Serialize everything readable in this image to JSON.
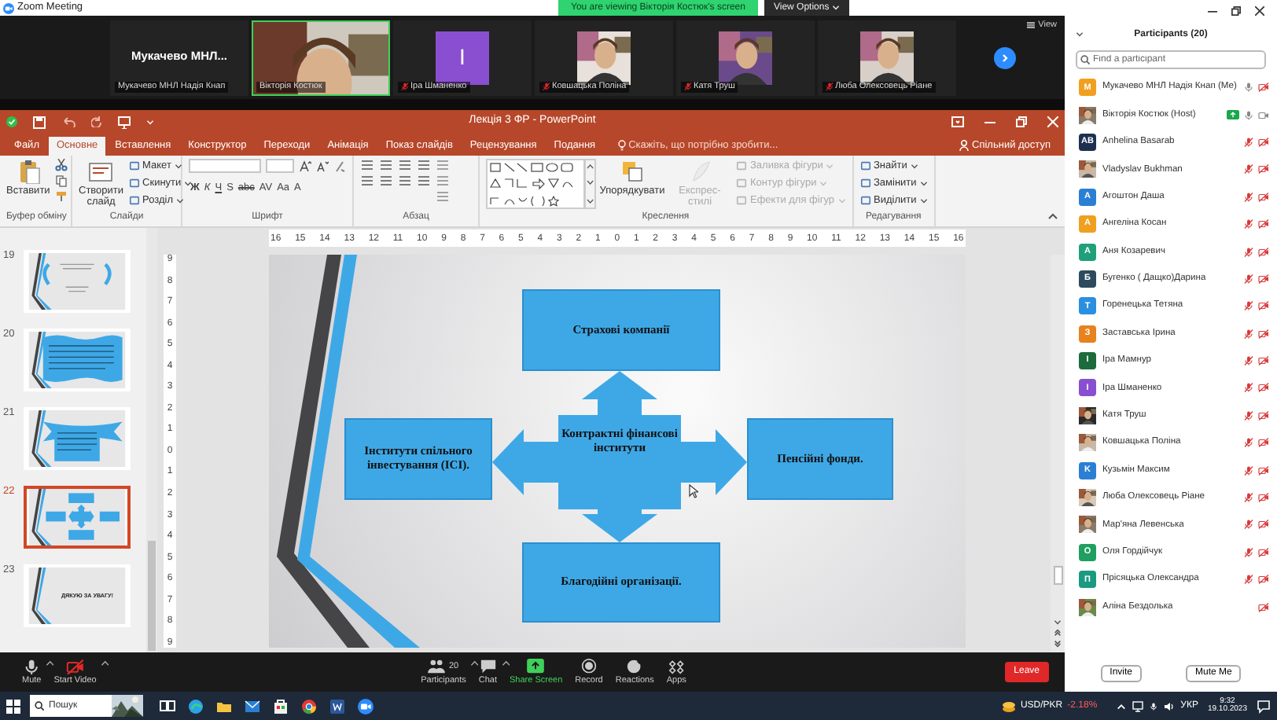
{
  "title_bar": {
    "title": "Zoom Meeting"
  },
  "share_banner": {
    "text": "You are viewing Вікторія Костюк's screen",
    "button": "View Options"
  },
  "gallery": {
    "tiles": [
      {
        "kind": "name",
        "display": "Мукачево  МНЛ...",
        "label": "Мукачево МНЛ Надія Кнап",
        "muted": false,
        "speaking": false
      },
      {
        "kind": "video",
        "label": "Вікторія Костюк",
        "muted": false,
        "speaking": true
      },
      {
        "kind": "letter",
        "initial": "І",
        "color": "#8a4fd0",
        "label": "Іра Шманенко",
        "muted": true,
        "speaking": false
      },
      {
        "label": "Ковшацька Поліна",
        "muted": true,
        "speaking": false
      },
      {
        "label": "Катя Труш",
        "muted": true,
        "speaking": false
      },
      {
        "label": "Люба Олексовець Ріане",
        "muted": true,
        "speaking": false
      }
    ],
    "view_label": "View"
  },
  "powerpoint": {
    "title": "Лекція 3 ФР  -  PowerPoint",
    "file_tab": "Файл",
    "tabs": [
      {
        "label": "Основне",
        "selected": true
      },
      {
        "label": "Вставлення",
        "selected": false
      },
      {
        "label": "Конструктор",
        "selected": false
      },
      {
        "label": "Переходи",
        "selected": false
      },
      {
        "label": "Анімація",
        "selected": false
      },
      {
        "label": "Показ слайдів",
        "selected": false
      },
      {
        "label": "Рецензування",
        "selected": false
      },
      {
        "label": "Подання",
        "selected": false
      }
    ],
    "tell_me": "Скажіть, що потрібно зробити...",
    "share": "Спільний доступ",
    "ribbon": [
      {
        "kind": "clipboard",
        "label": "Буфер обміну",
        "large": [
          {
            "label": "Вставити",
            "disabled": false
          }
        ]
      },
      {
        "kind": "slides",
        "label": "Слайди",
        "large": [
          {
            "label": "Створити слайд",
            "disabled": false
          }
        ],
        "small": [
          {
            "label": "Макет",
            "disabled": false
          },
          {
            "label": "Скинути",
            "disabled": false
          },
          {
            "label": "Розділ",
            "disabled": false
          }
        ]
      },
      {
        "kind": "font",
        "label": "Шрифт",
        "font_buttons": [
          "Ж",
          "К",
          "Ч",
          "S",
          "abc",
          "AV",
          "Aa",
          "A"
        ]
      },
      {
        "kind": "paragraph",
        "label": "Абзац"
      },
      {
        "kind": "drawing",
        "label": "Креслення",
        "large": [
          {
            "label": "Упорядкувати",
            "disabled": false
          },
          {
            "label": "Експрес-стилі",
            "disabled": true
          }
        ],
        "small": [
          {
            "label": "Заливка фігури",
            "disabled": true
          },
          {
            "label": "Контур фігури",
            "disabled": true
          },
          {
            "label": "Ефекти для фігур",
            "disabled": true
          }
        ]
      },
      {
        "kind": "editing",
        "label": "Редагування",
        "small": [
          {
            "label": "Знайти",
            "disabled": false
          },
          {
            "label": "Замінити",
            "disabled": false
          },
          {
            "label": "Виділити",
            "disabled": false
          }
        ]
      }
    ],
    "ruler_h": [
      "16",
      "15",
      "14",
      "13",
      "12",
      "11",
      "10",
      "9",
      "8",
      "7",
      "6",
      "5",
      "4",
      "3",
      "2",
      "1",
      "0",
      "1",
      "2",
      "3",
      "4",
      "5",
      "6",
      "7",
      "8",
      "9",
      "10",
      "11",
      "12",
      "13",
      "14",
      "15",
      "16"
    ],
    "ruler_v": [
      "9",
      "8",
      "7",
      "6",
      "5",
      "4",
      "3",
      "2",
      "1",
      "0",
      "1",
      "2",
      "3",
      "4",
      "5",
      "6",
      "7",
      "8",
      "9"
    ],
    "thumbnails": [
      {
        "number": "19",
        "kind": "brackets",
        "selected": false
      },
      {
        "number": "20",
        "kind": "wave",
        "selected": false
      },
      {
        "number": "21",
        "kind": "banner",
        "selected": false
      },
      {
        "number": "22",
        "kind": "diagram",
        "selected": true
      },
      {
        "number": "23",
        "kind": "title",
        "text": "ДЯКУЮ ЗА УВАГУ!",
        "selected": false
      }
    ],
    "slide": {
      "nodes": [
        {
          "kind": "top",
          "text": "Страхові компанії"
        },
        {
          "kind": "left",
          "text": "Інститути спільного інвестування (ІСІ)."
        },
        {
          "kind": "center",
          "text": "Контрактні фінансові інститути"
        },
        {
          "kind": "right",
          "text": "Пенсійні фонди."
        },
        {
          "kind": "bottom",
          "text": "Благодійні організації."
        }
      ]
    }
  },
  "toolbar": {
    "items": [
      {
        "kind": "mic",
        "label": "Mute"
      },
      {
        "kind": "video-off",
        "label": "Start Video"
      },
      {
        "kind": "participants",
        "label": "Participants",
        "count": "20"
      },
      {
        "kind": "chat",
        "label": "Chat"
      },
      {
        "kind": "share",
        "label": "Share Screen"
      },
      {
        "kind": "record",
        "label": "Record"
      },
      {
        "kind": "reactions",
        "label": "Reactions"
      },
      {
        "kind": "apps",
        "label": "Apps"
      }
    ],
    "leave": "Leave"
  },
  "participants_panel": {
    "title": "Participants (20)",
    "search_placeholder": "Find a participant",
    "rows": [
      {
        "name": "Мукачево МНЛ Надія Кнап (Me)",
        "kind": "letter",
        "initials": "M",
        "color": "#f0a020",
        "audio": true,
        "muted": false,
        "video_on": false,
        "sharing": false
      },
      {
        "name": "Вікторія Костюк (Host)",
        "audio": true,
        "muted": false,
        "video_on": true,
        "sharing": true
      },
      {
        "name": "Anhelina Basarab",
        "kind": "letter",
        "initials": "AB",
        "color": "#1e3050",
        "audio": true,
        "muted": true,
        "video_on": false,
        "sharing": false
      },
      {
        "name": "Vladyslav Bukhman",
        "audio": true,
        "muted": true,
        "video_on": false,
        "sharing": false
      },
      {
        "name": "Агоштон Даша",
        "kind": "letter",
        "initials": "A",
        "color": "#2a7fd4",
        "audio": true,
        "muted": true,
        "video_on": false,
        "sharing": false
      },
      {
        "name": "Ангеліна Косан",
        "kind": "letter",
        "initials": "A",
        "color": "#f0a020",
        "audio": true,
        "muted": true,
        "video_on": false,
        "sharing": false
      },
      {
        "name": "Аня Козаревич",
        "kind": "letter",
        "initials": "A",
        "color": "#1fa07a",
        "audio": true,
        "muted": true,
        "video_on": false,
        "sharing": false
      },
      {
        "name": "Бугенко ( Дащко)Дарина",
        "kind": "letter",
        "initials": "Б",
        "color": "#2e4a5e",
        "audio": true,
        "muted": true,
        "video_on": false,
        "sharing": false
      },
      {
        "name": "Горенецька Тетяна",
        "kind": "letter",
        "initials": "T",
        "color": "#2a8fe0",
        "audio": true,
        "muted": true,
        "video_on": false,
        "sharing": false
      },
      {
        "name": "Заставська Ірина",
        "kind": "letter",
        "initials": "З",
        "color": "#e8821e",
        "audio": true,
        "muted": true,
        "video_on": false,
        "sharing": false
      },
      {
        "name": "Іра Мамнур",
        "kind": "letter",
        "initials": "І",
        "color": "#1d6b3c",
        "audio": true,
        "muted": true,
        "video_on": false,
        "sharing": false
      },
      {
        "name": "Іра Шманенко",
        "kind": "letter",
        "initials": "І",
        "color": "#8a4fd0",
        "audio": true,
        "muted": true,
        "video_on": false,
        "sharing": false
      },
      {
        "name": "Катя Труш",
        "audio": true,
        "muted": true,
        "video_on": false,
        "sharing": false
      },
      {
        "name": "Ковшацька Поліна",
        "audio": true,
        "muted": true,
        "video_on": false,
        "sharing": false
      },
      {
        "name": "Кузьмін Максим",
        "kind": "letter",
        "initials": "K",
        "color": "#2a7fd4",
        "audio": true,
        "muted": true,
        "video_on": false,
        "sharing": false
      },
      {
        "name": "Люба Олексовець Ріане",
        "audio": true,
        "muted": true,
        "video_on": false,
        "sharing": false
      },
      {
        "name": "Мар'яна Левенська",
        "audio": true,
        "muted": true,
        "video_on": false,
        "sharing": false
      },
      {
        "name": "Оля Гордійчук",
        "kind": "letter",
        "initials": "O",
        "color": "#1fa060",
        "audio": true,
        "muted": true,
        "video_on": false,
        "sharing": false
      },
      {
        "name": "Прісяцька Олександра",
        "kind": "letter",
        "initials": "П",
        "color": "#1a9a80",
        "audio": true,
        "muted": true,
        "video_on": false,
        "sharing": false
      },
      {
        "name": "Аліна Бездолька",
        "audio": false,
        "video_on": false,
        "sharing": false
      }
    ],
    "buttons": [
      "Invite",
      "Mute Me"
    ]
  },
  "taskbar": {
    "search_placeholder": "Пошук",
    "ticker": "USD/PKR",
    "change": "-2.18%",
    "language": "УКР",
    "time": "9:32",
    "date": "19.10.2023"
  }
}
